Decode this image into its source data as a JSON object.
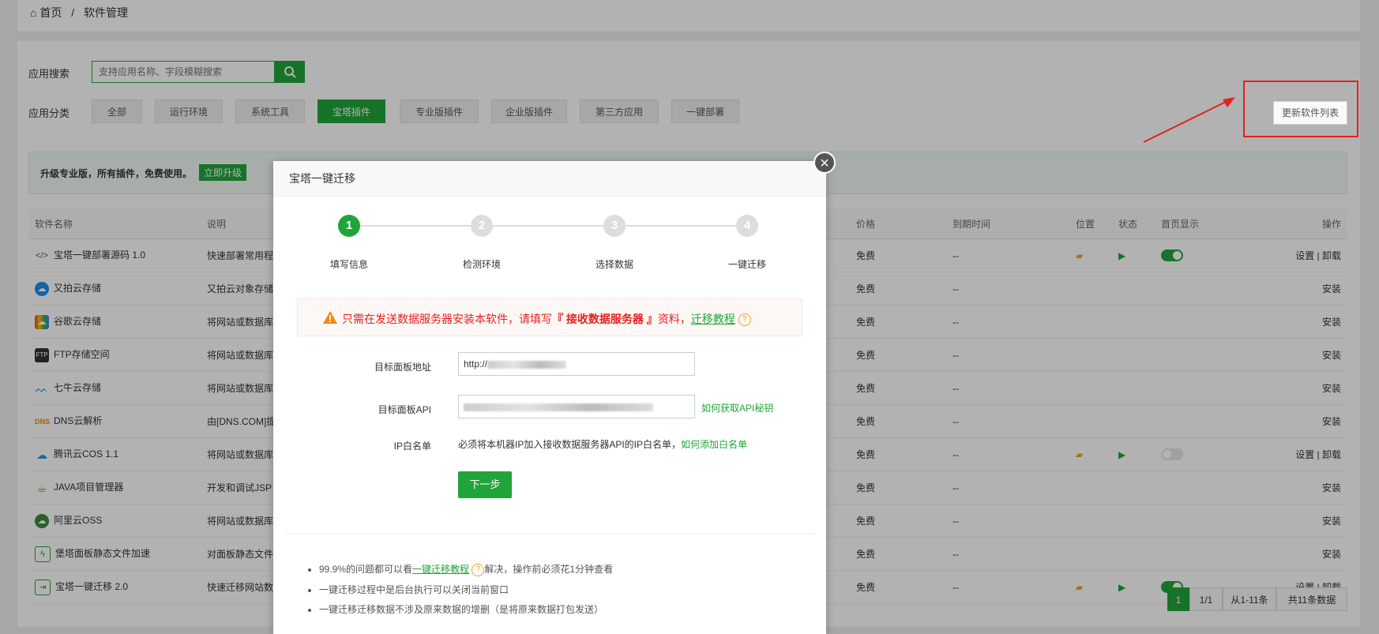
{
  "breadcrumb": {
    "home": "首页",
    "sep": "/",
    "current": "软件管理"
  },
  "search": {
    "label": "应用搜索",
    "placeholder": "支持应用名称、字段模糊搜索"
  },
  "category": {
    "label": "应用分类",
    "items": [
      "全部",
      "运行环境",
      "系统工具",
      "宝塔插件",
      "专业版插件",
      "企业版插件",
      "第三方应用",
      "一键部署"
    ],
    "active_index": 3
  },
  "refresh_button": "更新软件列表",
  "banner": {
    "text": "升级专业版，所有插件，免费使用。",
    "button": "立即升级"
  },
  "table": {
    "headers": [
      "软件名称",
      "说明",
      "价格",
      "到期时间",
      "位置",
      "状态",
      "首页显示",
      "操作"
    ],
    "rows": [
      {
        "name": "宝塔一键部署源码 1.0",
        "desc": "快速部署常用程",
        "price": "免费",
        "expire": "--",
        "action": "设置 | 卸载",
        "installed": true,
        "toggle": true,
        "icon": "code-icon"
      },
      {
        "name": "又拍云存储",
        "desc": "又拍云对象存储",
        "price": "免费",
        "expire": "--",
        "action": "安装",
        "installed": false,
        "icon": "upyun-icon"
      },
      {
        "name": "谷歌云存储",
        "desc": "将网站或数据库",
        "price": "免费",
        "expire": "--",
        "action": "安装",
        "installed": false,
        "icon": "google-cloud-icon"
      },
      {
        "name": "FTP存储空间",
        "desc": "将网站或数据库",
        "price": "免费",
        "expire": "--",
        "action": "安装",
        "installed": false,
        "icon": "ftp-icon"
      },
      {
        "name": "七牛云存储",
        "desc": "将网站或数据库",
        "price": "免费",
        "expire": "--",
        "action": "安装",
        "installed": false,
        "icon": "qiniu-icon"
      },
      {
        "name": "DNS云解析",
        "desc": "由[DNS.COM]提",
        "price": "免费",
        "expire": "--",
        "action": "安装",
        "installed": false,
        "icon": "dns-icon"
      },
      {
        "name": "腾讯云COS 1.1",
        "desc": "将网站或数据库",
        "price": "免费",
        "expire": "--",
        "action": "设置 | 卸载",
        "installed": true,
        "toggle": false,
        "icon": "tencent-cloud-icon"
      },
      {
        "name": "JAVA项目管理器",
        "desc": "开发和调试JSP",
        "price": "免费",
        "expire": "--",
        "action": "安装",
        "installed": false,
        "icon": "java-icon"
      },
      {
        "name": "阿里云OSS",
        "desc": "将网站或数据库",
        "price": "免费",
        "expire": "--",
        "action": "安装",
        "installed": false,
        "icon": "aliyun-icon"
      },
      {
        "name": "堡塔面板静态文件加速",
        "desc": "对面板静态文件",
        "price": "免费",
        "expire": "--",
        "action": "安装",
        "installed": false,
        "icon": "bolt-icon"
      },
      {
        "name": "宝塔一键迁移 2.0",
        "desc": "快速迁移网站数",
        "price": "免费",
        "expire": "--",
        "action": "设置 | 卸载",
        "installed": true,
        "toggle": true,
        "icon": "migrate-icon"
      }
    ]
  },
  "pager": {
    "current": "1",
    "total_pages": "1/1",
    "range": "从1-11条",
    "count": "共11条数据"
  },
  "modal": {
    "title": "宝塔一键迁移",
    "steps": [
      {
        "num": "1",
        "label": "填写信息"
      },
      {
        "num": "2",
        "label": "检测环境"
      },
      {
        "num": "3",
        "label": "选择数据"
      },
      {
        "num": "4",
        "label": "一键迁移"
      }
    ],
    "active_step": 1,
    "warning": {
      "prefix": "只需在发送数据服务器安装本软件，请填写",
      "bold": "『 接收数据服务器 』",
      "suffix": "资料，",
      "link": "迁移教程"
    },
    "fields": {
      "url_label": "目标面板地址",
      "url_value": "http://",
      "api_label": "目标面板API",
      "api_link": "如何获取API秘钥",
      "ip_label": "IP白名单",
      "ip_text": "必须将本机器IP加入接收数据服务器API的IP白名单，",
      "ip_link": "如何添加白名单"
    },
    "next_button": "下一步",
    "notes": {
      "n1_prefix": "99.9%的问题都可以看",
      "n1_link": "一键迁移教程",
      "n1_suffix": "解决，操作前必须花1分钟查看",
      "n2": "一键迁移过程中是后台执行可以关闭当前窗口",
      "n3": "一键迁移迁移数据不涉及原来数据的增删（是将原来数据打包发送）"
    }
  },
  "colors": {
    "accent": "#20a53a",
    "warning": "#e81f1f",
    "annotation": "#e81f1f"
  }
}
